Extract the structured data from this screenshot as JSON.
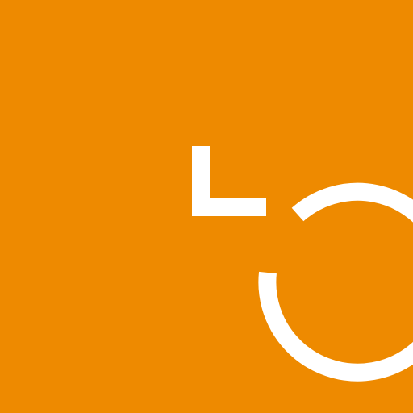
{
  "app_icon": {
    "icon_name": "clock-icon",
    "background_color": "#ee8a00",
    "foreground_color": "#ffffff"
  }
}
